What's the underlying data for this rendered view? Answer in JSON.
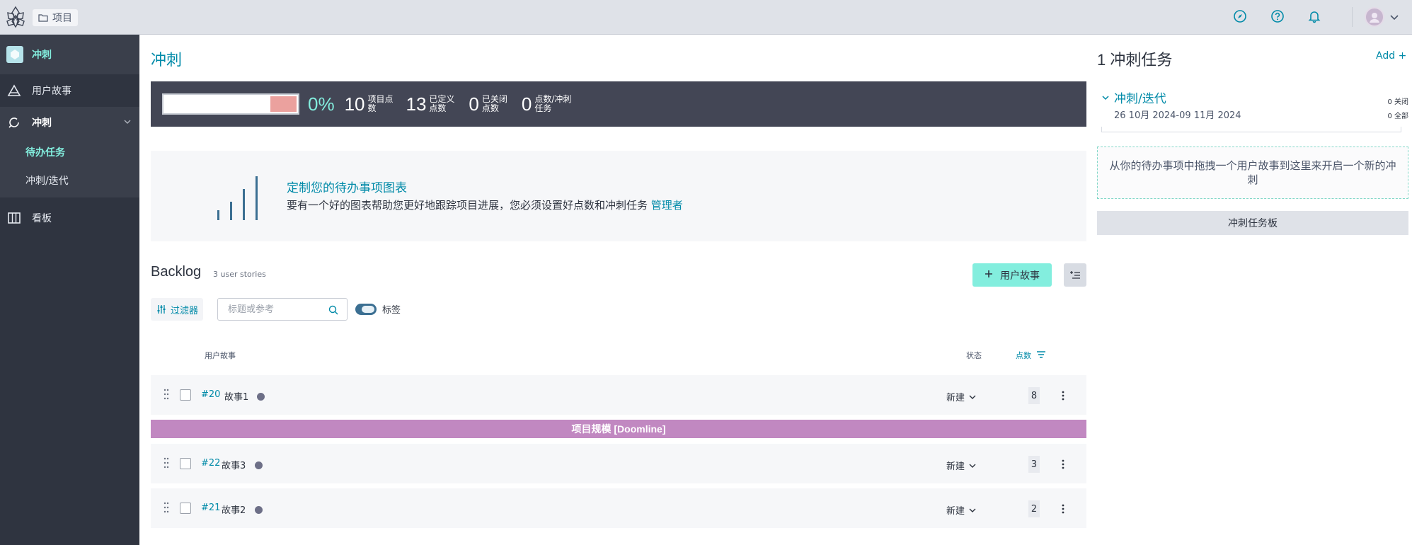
{
  "topbar": {
    "breadcrumb": "项目",
    "icons": [
      "compass-icon",
      "help-icon",
      "bell-icon",
      "avatar",
      "chevron-down-icon"
    ]
  },
  "sidebar": {
    "project_label": "冲刺",
    "items": [
      {
        "label": "用户故事",
        "icon": "triangle-icon"
      },
      {
        "label": "冲刺",
        "icon": "sprint-icon"
      },
      {
        "label": "看板",
        "icon": "kanban-icon"
      }
    ],
    "sub_items": [
      {
        "label": "待办任务",
        "active": true
      },
      {
        "label": "冲刺/迭代",
        "active": false
      }
    ]
  },
  "main": {
    "title": "冲刺",
    "summary": {
      "percent": "0%",
      "progress_fraction": 0.2,
      "stats": [
        {
          "num": "10",
          "label": "项目点数"
        },
        {
          "num": "13",
          "label": "已定义点数"
        },
        {
          "num": "0",
          "label": "已关闭点数"
        },
        {
          "num": "0",
          "label": "点数/冲刺任务"
        }
      ]
    },
    "chart_promo": {
      "title": "定制您的待办事项图表",
      "desc": "要有一个好的图表帮助您更好地跟踪项目进展，您必须设置好点数和冲刺任务",
      "link": "管理者"
    },
    "backlog": {
      "title": "Backlog",
      "count": "3 user stories",
      "add_button": "用户故事",
      "filter_button": "过滤器",
      "search_placeholder": "标题或参考",
      "tags_toggle_label": "标签",
      "tags_toggle_on": true,
      "columns": {
        "story": "用户故事",
        "status": "状态",
        "points": "点数"
      },
      "rows": [
        {
          "ref": "#20",
          "subject": "故事1",
          "status": "新建",
          "points": "8"
        },
        {
          "ref": "#22",
          "subject": "故事3",
          "status": "新建",
          "points": "3"
        },
        {
          "ref": "#21",
          "subject": "故事2",
          "status": "新建",
          "points": "2"
        }
      ],
      "doomline": "项目规模 [Doomline]"
    }
  },
  "right_panel": {
    "title": "1 冲刺任务",
    "add": "Add",
    "sprint": {
      "name": "冲刺/迭代",
      "dates": "26 10月 2024-09 11月 2024",
      "closed": "0 关闭",
      "total": "0 全部"
    },
    "drop_hint": "从你的待办事项中拖拽一个用户故事到这里来开启一个新的冲刺",
    "taskboard_button": "冲刺任务板"
  },
  "colors": {
    "accent": "#83eede",
    "link": "#008aa8",
    "sidebar_bg": "#2f3440",
    "summary_bg": "#434655",
    "doomline": "#c188c1",
    "status_dot": "#6d6f87"
  }
}
